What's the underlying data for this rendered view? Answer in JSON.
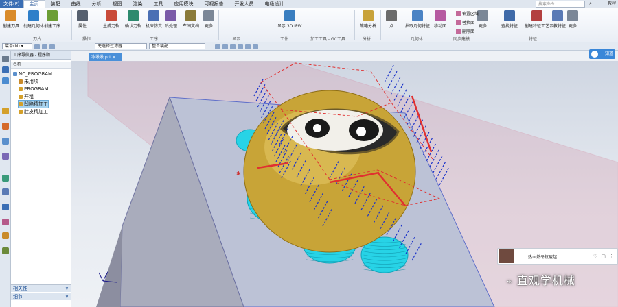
{
  "menu": {
    "file": "文件(F)",
    "items": [
      "主页",
      "装配",
      "曲线",
      "分析",
      "视图",
      "渲染",
      "工具",
      "应用模块",
      "可视报告",
      "开发人员",
      "电极设计"
    ],
    "active_index": 0
  },
  "search": {
    "placeholder": "搜索命令"
  },
  "toplink": "教程",
  "ribbon": {
    "buttons": [
      {
        "label": "创建刀具",
        "color": "#d98b2b",
        "icon": "tool-icon"
      },
      {
        "label": "创建几何体",
        "color": "#2f7fc9",
        "icon": "geometry-icon"
      },
      {
        "label": "创建工序",
        "color": "#6c9e35",
        "icon": "operation-icon"
      },
      {
        "label": "属性",
        "color": "#555f6e",
        "icon": "properties-icon"
      },
      {
        "label": "生成刀轨",
        "color": "#c94b3a",
        "icon": "generate-icon"
      },
      {
        "label": "确认刀轨",
        "color": "#2d8a6e",
        "icon": "verify-icon"
      },
      {
        "label": "机床仿真",
        "color": "#4a6fb4",
        "icon": "simulate-icon"
      },
      {
        "label": "后处理",
        "color": "#7a5aa8",
        "icon": "postprocess-icon"
      },
      {
        "label": "车间文档",
        "color": "#8a7a3a",
        "icon": "document-icon"
      },
      {
        "label": "更多",
        "color": "#7b8797",
        "icon": "more-icon"
      },
      {
        "label": "显示 3D IPW",
        "color": "#3a7ec0",
        "icon": "ipw-icon"
      },
      {
        "label": "策略分析",
        "color": "#c8a23a",
        "icon": "analysis-icon"
      },
      {
        "label": "点",
        "color": "#6b6b6b",
        "icon": "point-icon"
      },
      {
        "label": "抽取几何特征",
        "color": "#4b83c4",
        "icon": "extract-icon"
      },
      {
        "label": "移动面",
        "color": "#b65aa1",
        "icon": "move-face-icon"
      },
      {
        "label": "更多",
        "color": "#7b8797",
        "icon": "more-icon"
      },
      {
        "label": "查找特征",
        "color": "#3f6aa8",
        "icon": "find-feature-icon"
      },
      {
        "label": "创建特征工艺",
        "color": "#b34040",
        "icon": "feature-process-icon"
      },
      {
        "label": "示教特征",
        "color": "#5a7ab5",
        "icon": "teach-feature-icon"
      },
      {
        "label": "更多",
        "color": "#7b8797",
        "icon": "more-icon"
      }
    ],
    "mini": [
      "偏置区域",
      "替换面",
      "删除面"
    ],
    "groups": [
      "刀片",
      "操作",
      "工序",
      "显示",
      "工件",
      "加工工具 - GC工具...",
      "分析",
      "几何体",
      "同步建模",
      "特征"
    ]
  },
  "toolbar": {
    "menu": "菜单(M) ▾",
    "filter": "无选择过滤器",
    "assembly": "整个装配"
  },
  "navigator": {
    "title": "工序导航器 - 程序顺...",
    "col": "名称",
    "items": [
      {
        "label": "NC_PROGRAM",
        "level": 0
      },
      {
        "label": "未用项",
        "level": 1
      },
      {
        "label": "PROGRAM",
        "level": 1
      },
      {
        "label": "开粗",
        "level": 1
      },
      {
        "label": "凹陷精加工",
        "level": 1
      },
      {
        "label": "肚皮精加工",
        "level": 1
      }
    ],
    "selected": 4,
    "footers": [
      "相关性",
      "细节"
    ]
  },
  "viewtab": "冰墩墩.prt ⊗",
  "logo": "知道",
  "video": {
    "title": "热血燃冬抗疫起",
    "icons": [
      "♡",
      "▢",
      "⋮"
    ]
  },
  "watermark": "直观学机械",
  "colors": {
    "ribbonAccent": "#3b6fb5",
    "gold": "#c8a437",
    "cyan": "#27d3e6",
    "blue": "#1b33c9",
    "red": "#e03030",
    "plane": "#d7a3b4"
  }
}
